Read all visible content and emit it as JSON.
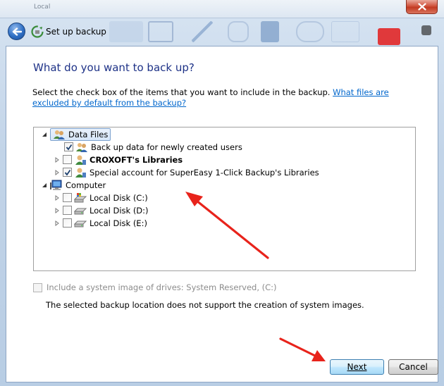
{
  "window": {
    "title": "Set up backup",
    "close_glyph": "X",
    "background_menu": [
      "",
      "Local"
    ]
  },
  "page": {
    "heading": "What do you want to back up?",
    "instruction": "Select the check box of the items that you want to include in the backup.",
    "help_link": "What files are excluded by default from the backup?"
  },
  "tree": {
    "nodes": [
      {
        "label": "Data Files",
        "level": 0,
        "expanded": true,
        "checkbox": false,
        "selected": true,
        "bold": false,
        "icon": "users-icon"
      },
      {
        "label": "Back up data for newly created users",
        "level": 1,
        "expander": false,
        "checked": true,
        "bold": false,
        "icon": "users-icon"
      },
      {
        "label": "CROXOFT's Libraries",
        "level": 1,
        "expander": true,
        "checked": false,
        "bold": true,
        "icon": "user-icon"
      },
      {
        "label": "Special account for SuperEasy 1-Click Backup's Libraries",
        "level": 1,
        "expander": true,
        "checked": true,
        "bold": false,
        "icon": "user-icon"
      },
      {
        "label": "Computer",
        "level": 0,
        "expanded": true,
        "checkbox": false,
        "bold": false,
        "icon": "computer-icon"
      },
      {
        "label": "Local Disk (C:)",
        "level": 1,
        "expander": true,
        "checked": false,
        "bold": false,
        "icon": "system-drive-icon"
      },
      {
        "label": "Local Disk (D:)",
        "level": 1,
        "expander": true,
        "checked": false,
        "bold": false,
        "icon": "drive-icon"
      },
      {
        "label": "Local Disk (E:)",
        "level": 1,
        "expander": true,
        "checked": false,
        "bold": false,
        "icon": "drive-icon"
      }
    ]
  },
  "system_image": {
    "label": "Include a system image of drives: System Reserved, (C:)",
    "checked": false,
    "enabled": false,
    "note": "The selected backup location does not support the creation of system images."
  },
  "buttons": {
    "next": "Next",
    "cancel": "Cancel"
  },
  "colors": {
    "heading": "#1e3287",
    "link": "#0066cc",
    "annotation_arrow": "#e8231b"
  }
}
